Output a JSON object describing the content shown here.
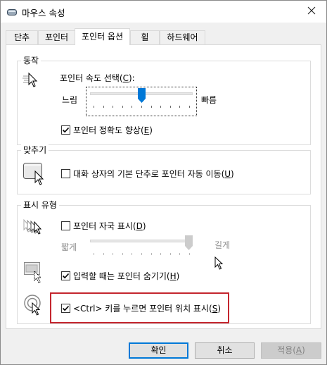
{
  "window": {
    "title": "마우스 속성"
  },
  "tabs": [
    {
      "label": "단추"
    },
    {
      "label": "포인터"
    },
    {
      "label": "포인터 옵션"
    },
    {
      "label": "휠"
    },
    {
      "label": "하드웨어"
    }
  ],
  "motion": {
    "group_label": "동작",
    "speed_label_text": "포인터 속도 선택(",
    "speed_label_key": "C",
    "speed_label_end": "):",
    "slow_label": "느림",
    "fast_label": "빠름",
    "speed_value_fraction": 0.5,
    "precision_text": "포인터 정확도 향상(",
    "precision_key": "E",
    "precision_end": ")",
    "precision_checked": true
  },
  "snap": {
    "group_label": "맞추기",
    "snap_text": "대화 상자의 기본 단추로 포인터 자동 이동(",
    "snap_key": "U",
    "snap_end": ")",
    "snap_checked": false
  },
  "visibility": {
    "group_label": "표시 유형",
    "trails_text": "포인터 자국 표시(",
    "trails_key": "D",
    "trails_end": ")",
    "trails_checked": false,
    "short_label": "짧게",
    "long_label": "길게",
    "trails_value_fraction": 1.0,
    "hide_text": "입력할 때는 포인터 숨기기(",
    "hide_key": "H",
    "hide_end": ")",
    "hide_checked": true,
    "ctrl_text": "<Ctrl> 키를 누르면 포인터 위치 표시(",
    "ctrl_key": "S",
    "ctrl_end": ")",
    "ctrl_checked": true
  },
  "buttons": {
    "ok_label": "확인",
    "cancel_label": "취소",
    "apply_text": "적용(",
    "apply_key": "A",
    "apply_end": ")"
  },
  "colors": {
    "accent": "#0078d7",
    "highlight_border": "#c4262e"
  }
}
